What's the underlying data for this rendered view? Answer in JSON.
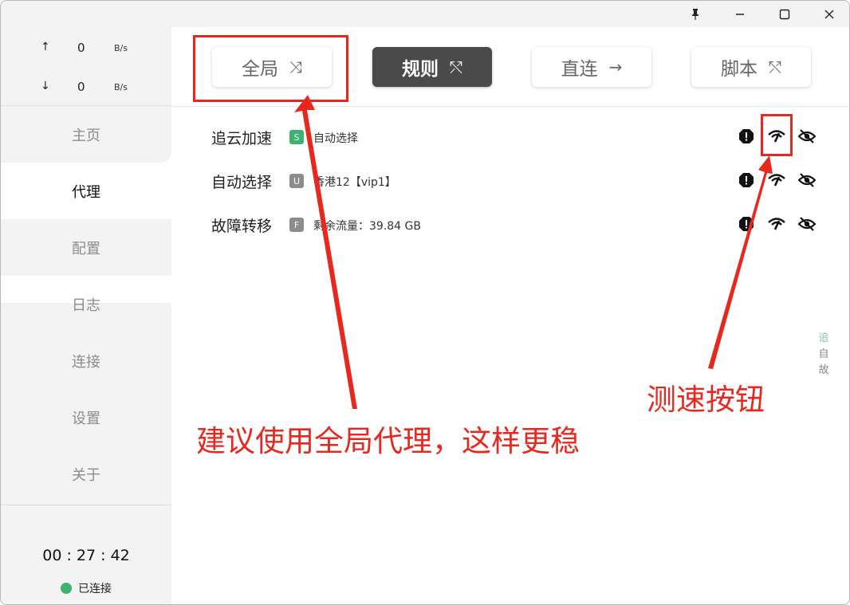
{
  "speed": {
    "upload_arrow": "↑",
    "upload_value": "0",
    "upload_unit": "B/s",
    "download_arrow": "↓",
    "download_value": "0",
    "download_unit": "B/s"
  },
  "nav": {
    "items": [
      {
        "label": "主页"
      },
      {
        "label": "代理"
      },
      {
        "label": "配置"
      },
      {
        "label": "日志"
      },
      {
        "label": "连接"
      },
      {
        "label": "设置"
      },
      {
        "label": "关于"
      }
    ],
    "active_index": 1
  },
  "footer": {
    "timer": "00 : 27 : 42",
    "status": "已连接",
    "status_color": "#3cb371"
  },
  "modes": [
    {
      "label": "全局",
      "symbol": "⤨",
      "active": false
    },
    {
      "label": "规则",
      "symbol": "⤲",
      "active": true
    },
    {
      "label": "直连",
      "symbol": "→",
      "active": false
    },
    {
      "label": "脚本",
      "symbol": "⤲",
      "active": false
    }
  ],
  "groups": [
    {
      "name": "追云加速",
      "badge": "S",
      "badge_color": "#3cb371",
      "current": "自动选择"
    },
    {
      "name": "自动选择",
      "badge": "U",
      "badge_color": "#8c8c8c",
      "current": "香港12【vip1】"
    },
    {
      "name": "故障转移",
      "badge": "F",
      "badge_color": "#8c8c8c",
      "current": "剩余流量：39.84 GB"
    }
  ],
  "mini_list": [
    "追",
    "自",
    "故"
  ],
  "annotations": {
    "global_hint": "建议使用全局代理，这样更稳",
    "speedtest_hint": "测速按钮",
    "color": "#e8281e"
  },
  "icons": {
    "pin": "pin-icon",
    "maximize": "maximize-icon",
    "close": "close-icon",
    "alert": "alert-icon",
    "speedtest": "speedtest-icon",
    "hide": "eye-off-icon"
  }
}
